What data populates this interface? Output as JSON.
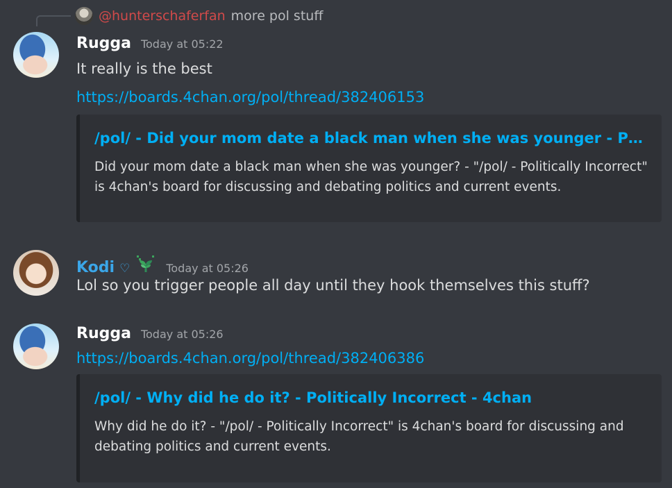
{
  "reply": {
    "mention": "@hunterschaferfan",
    "text": "more pol stuff"
  },
  "messages": [
    {
      "username": "Rugga",
      "timestamp": "Today at 05:22",
      "text": "It really is the best",
      "link": "https://boards.4chan.org/pol/thread/382406153",
      "embed": {
        "title": "/pol/ - Did your mom date a black man when she was younger - Politi...",
        "description": "Did your mom date a black man when she was younger? - \"/pol/ - Politically Incorrect\" is 4chan's board for discussing and debating politics and current events."
      }
    },
    {
      "username": "Kodi",
      "heart": "♡",
      "timestamp": "Today at 05:26",
      "text": "Lol so you trigger people all day until they hook themselves this stuff?"
    },
    {
      "username": "Rugga",
      "timestamp": "Today at 05:26",
      "link": "https://boards.4chan.org/pol/thread/382406386",
      "embed": {
        "title": "/pol/ - Why did he do it? - Politically Incorrect - 4chan",
        "description": "Why did he do it? - \"/pol/ - Politically Incorrect\" is 4chan's board for discussing and debating politics and current events."
      }
    }
  ],
  "colors": {
    "background": "#36393f",
    "embed_background": "#2f3136",
    "link": "#00aff4",
    "mention": "#d14a4a",
    "kodi_name": "#3ba6e8"
  },
  "icons": {
    "kodi_badge": "plant-sprout-icon"
  }
}
